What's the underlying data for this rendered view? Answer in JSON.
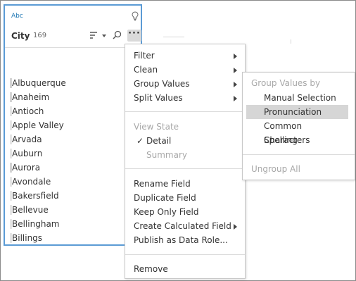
{
  "field_card": {
    "type_label": "Abc",
    "field_name": "City",
    "field_count": "169",
    "icons": {
      "bulb": "lightbulb-icon",
      "sort": "sort-icon",
      "caret": "caret-down-icon",
      "search": "search-icon",
      "more": "more-options-icon"
    },
    "more_label": "···",
    "values": [
      {
        "label": "Albuquerque",
        "marked": true
      },
      {
        "label": "Anaheim",
        "marked": true
      },
      {
        "label": "Antioch",
        "marked": false
      },
      {
        "label": "Apple Valley",
        "marked": false
      },
      {
        "label": "Arvada",
        "marked": false
      },
      {
        "label": "Auburn",
        "marked": false
      },
      {
        "label": "Aurora",
        "marked": true
      },
      {
        "label": "Avondale",
        "marked": false
      },
      {
        "label": "Bakersfield",
        "marked": false
      },
      {
        "label": "Bellevue",
        "marked": false
      },
      {
        "label": "Bellingham",
        "marked": false
      },
      {
        "label": "Billings",
        "marked": false
      }
    ]
  },
  "context_menu": {
    "filter": "Filter",
    "clean": "Clean",
    "group_values": "Group Values",
    "split_values": "Split Values",
    "view_state": "View State",
    "detail": "Detail",
    "detail_check": "✓",
    "summary": "Summary",
    "rename_field": "Rename Field",
    "duplicate_field": "Duplicate Field",
    "keep_only_field": "Keep Only Field",
    "create_calculated_field": "Create Calculated Field",
    "publish_as_data_role": "Publish as Data Role...",
    "remove": "Remove"
  },
  "group_values_submenu": {
    "header": "Group Values by",
    "manual_selection": "Manual Selection",
    "pronunciation": "Pronunciation",
    "common_characters": "Common Characters",
    "spelling": "Spelling",
    "ungroup_all": "Ungroup All"
  },
  "colors": {
    "accent": "#5b9bd5",
    "selected_bg": "#d6d6d6",
    "disabled_text": "#a8a8a8"
  }
}
